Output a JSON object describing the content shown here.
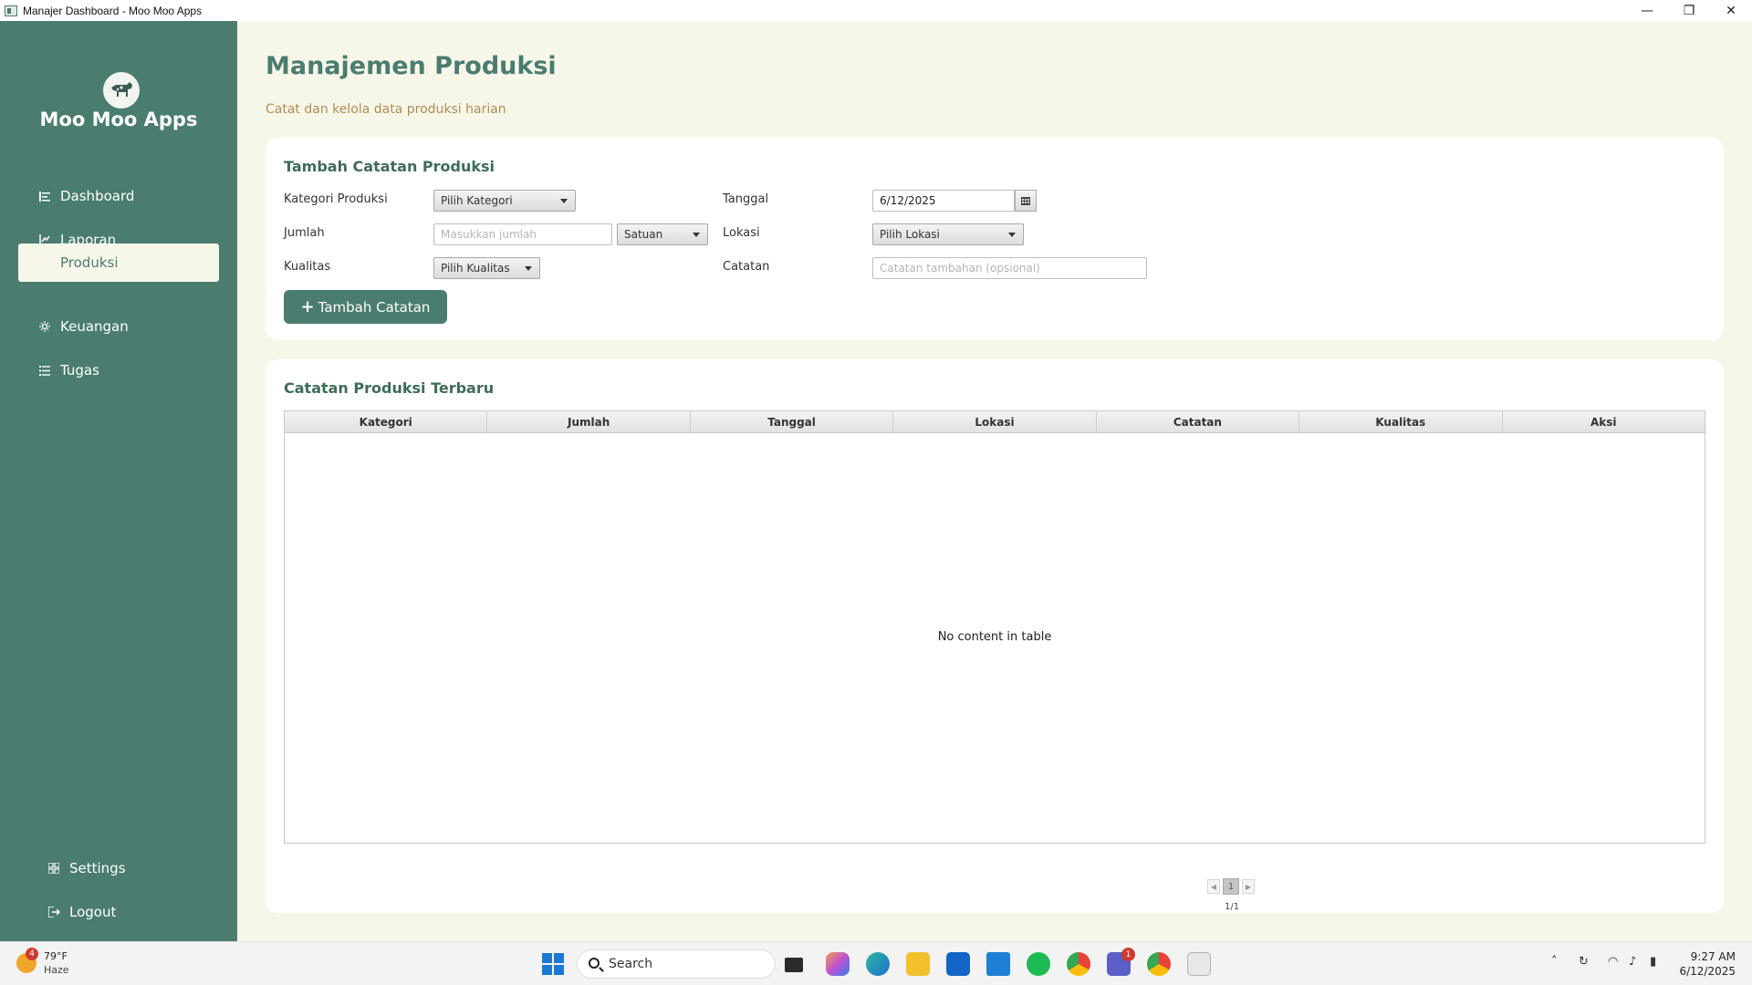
{
  "window": {
    "title": "Manajer Dashboard - Moo Moo Apps",
    "controls": [
      "minimize",
      "restore",
      "close"
    ]
  },
  "sidebar": {
    "app_name": "Moo Moo Apps",
    "items": [
      {
        "label": "Dashboard",
        "icon": "dashboard-icon"
      },
      {
        "label": "Laporan",
        "icon": "report-icon"
      },
      {
        "label": "Produksi",
        "icon": "production-icon",
        "active": true
      },
      {
        "label": "Keuangan",
        "icon": "finance-icon"
      },
      {
        "label": "Tugas",
        "icon": "tasks-icon"
      }
    ],
    "bottom": [
      {
        "label": "Settings",
        "icon": "settings-icon"
      },
      {
        "label": "Logout",
        "icon": "logout-icon"
      }
    ]
  },
  "page": {
    "title": "Manajemen Produksi",
    "subtitle": "Catat dan kelola data produksi harian"
  },
  "form": {
    "title": "Tambah Catatan Produksi",
    "kategori_label": "Kategori Produksi",
    "kategori_value": "Pilih Kategori",
    "jumlah_label": "Jumlah",
    "jumlah_placeholder": "Masukkan jumlah",
    "satuan_value": "Satuan",
    "kualitas_label": "Kualitas",
    "kualitas_value": "Pilih Kualitas",
    "tanggal_label": "Tanggal",
    "tanggal_value": "6/12/2025",
    "lokasi_label": "Lokasi",
    "lokasi_value": "Pilih Lokasi",
    "catatan_label": "Catatan",
    "catatan_placeholder": "Catatan tambahan (opsional)",
    "submit_label": "Tambah Catatan"
  },
  "table": {
    "title": "Catatan Produksi Terbaru",
    "columns": [
      "Kategori",
      "Jumlah",
      "Tanggal",
      "Lokasi",
      "Catatan",
      "Kualitas",
      "Aksi"
    ],
    "rows": [],
    "empty_message": "No content in table",
    "pagination": {
      "current": "1",
      "info": "1/1"
    }
  },
  "taskbar": {
    "weather_temp": "79°F",
    "weather_desc": "Haze",
    "weather_badge": "4",
    "search_label": "Search",
    "teams_badge": "1",
    "time": "9:27 AM",
    "date": "6/12/2025"
  },
  "colors": {
    "sidebar": "#4a7c70",
    "background": "#f7f7e9",
    "accent_text": "#b08b54",
    "card": "#ffffff"
  }
}
